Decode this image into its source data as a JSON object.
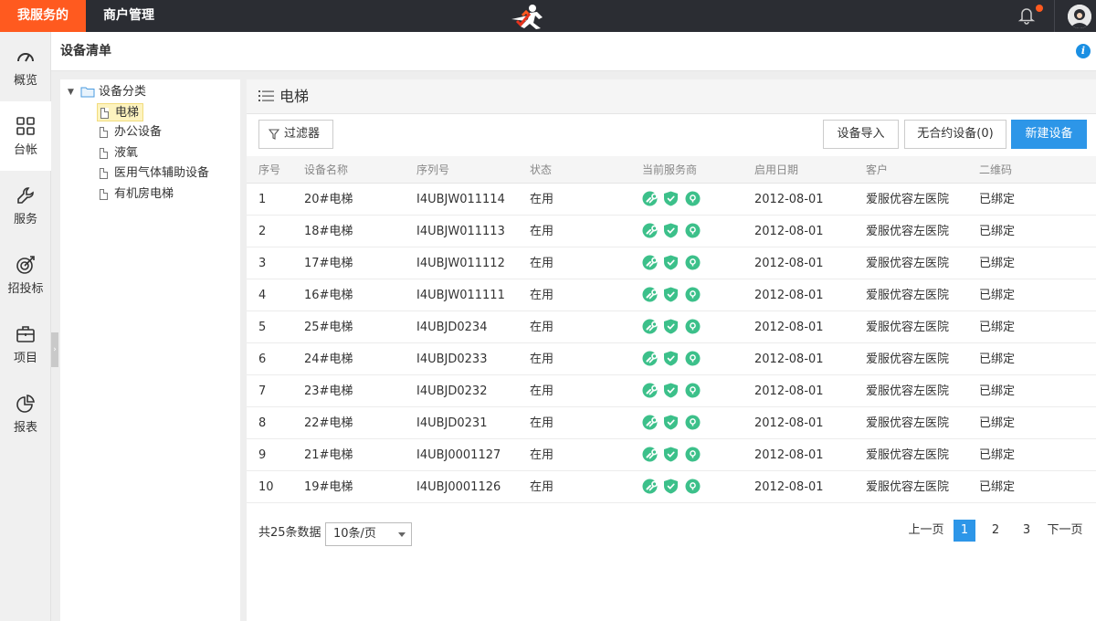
{
  "topbar": {
    "active_tab": "我服务的",
    "merchant_tab": "商户管理"
  },
  "leftnav": [
    {
      "label": "概览",
      "icon": "gauge-icon"
    },
    {
      "label": "台帐",
      "icon": "grid-icon",
      "active": true
    },
    {
      "label": "服务",
      "icon": "wrench-icon"
    },
    {
      "label": "招投标",
      "icon": "target-icon"
    },
    {
      "label": "项目",
      "icon": "briefcase-icon"
    },
    {
      "label": "报表",
      "icon": "pie-chart-icon"
    }
  ],
  "page": {
    "title": "设备清单"
  },
  "tree": {
    "root": "设备分类",
    "items": [
      "电梯",
      "办公设备",
      "液氧",
      "医用气体辅助设备",
      "有机房电梯"
    ],
    "selected": "电梯"
  },
  "main": {
    "section_title": "电梯",
    "buttons": {
      "filter": "过滤器",
      "import": "设备导入",
      "no_contract": "无合约设备(0)",
      "new": "新建设备"
    },
    "columns": [
      "序号",
      "设备名称",
      "序列号",
      "状态",
      "当前服务商",
      "启用日期",
      "客户",
      "二维码"
    ],
    "rows": [
      {
        "no": "1",
        "name": "20#电梯",
        "serial": "I4UBJW011114",
        "status": "在用",
        "date": "2012-08-01",
        "customer": "爱服优容左医院",
        "qr": "已绑定"
      },
      {
        "no": "2",
        "name": "18#电梯",
        "serial": "I4UBJW011113",
        "status": "在用",
        "date": "2012-08-01",
        "customer": "爱服优容左医院",
        "qr": "已绑定"
      },
      {
        "no": "3",
        "name": "17#电梯",
        "serial": "I4UBJW011112",
        "status": "在用",
        "date": "2012-08-01",
        "customer": "爱服优容左医院",
        "qr": "已绑定"
      },
      {
        "no": "4",
        "name": "16#电梯",
        "serial": "I4UBJW011111",
        "status": "在用",
        "date": "2012-08-01",
        "customer": "爱服优容左医院",
        "qr": "已绑定"
      },
      {
        "no": "5",
        "name": "25#电梯",
        "serial": "I4UBJD0234",
        "status": "在用",
        "date": "2012-08-01",
        "customer": "爱服优容左医院",
        "qr": "已绑定"
      },
      {
        "no": "6",
        "name": "24#电梯",
        "serial": "I4UBJD0233",
        "status": "在用",
        "date": "2012-08-01",
        "customer": "爱服优容左医院",
        "qr": "已绑定"
      },
      {
        "no": "7",
        "name": "23#电梯",
        "serial": "I4UBJD0232",
        "status": "在用",
        "date": "2012-08-01",
        "customer": "爱服优容左医院",
        "qr": "已绑定"
      },
      {
        "no": "8",
        "name": "22#电梯",
        "serial": "I4UBJD0231",
        "status": "在用",
        "date": "2012-08-01",
        "customer": "爱服优容左医院",
        "qr": "已绑定"
      },
      {
        "no": "9",
        "name": "21#电梯",
        "serial": "I4UBJ0001127",
        "status": "在用",
        "date": "2012-08-01",
        "customer": "爱服优容左医院",
        "qr": "已绑定"
      },
      {
        "no": "10",
        "name": "19#电梯",
        "serial": "I4UBJ0001126",
        "status": "在用",
        "date": "2012-08-01",
        "customer": "爱服优容左医院",
        "qr": "已绑定"
      }
    ],
    "service_icons": [
      "wrench-icon",
      "shield-check-icon",
      "location-pin-icon"
    ],
    "service_color": "#3cc08a"
  },
  "footer": {
    "total": "共25条数据",
    "page_size": "10条/页",
    "prev": "上一页",
    "pages": [
      "1",
      "2",
      "3"
    ],
    "current_page": "1",
    "next": "下一页"
  },
  "colors": {
    "accent": "#ff5a1f",
    "primary": "#2d96e8",
    "topbar": "#2b2d33"
  }
}
